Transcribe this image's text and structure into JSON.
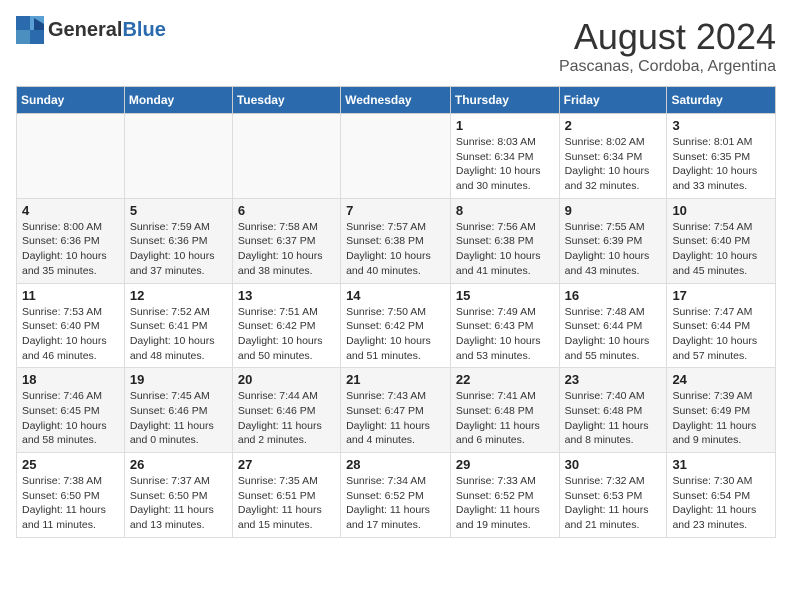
{
  "header": {
    "logo_general": "General",
    "logo_blue": "Blue",
    "title": "August 2024",
    "subtitle": "Pascanas, Cordoba, Argentina"
  },
  "calendar": {
    "days_of_week": [
      "Sunday",
      "Monday",
      "Tuesday",
      "Wednesday",
      "Thursday",
      "Friday",
      "Saturday"
    ],
    "weeks": [
      [
        {
          "num": "",
          "info": ""
        },
        {
          "num": "",
          "info": ""
        },
        {
          "num": "",
          "info": ""
        },
        {
          "num": "",
          "info": ""
        },
        {
          "num": "1",
          "info": "Sunrise: 8:03 AM\nSunset: 6:34 PM\nDaylight: 10 hours and 30 minutes."
        },
        {
          "num": "2",
          "info": "Sunrise: 8:02 AM\nSunset: 6:34 PM\nDaylight: 10 hours and 32 minutes."
        },
        {
          "num": "3",
          "info": "Sunrise: 8:01 AM\nSunset: 6:35 PM\nDaylight: 10 hours and 33 minutes."
        }
      ],
      [
        {
          "num": "4",
          "info": "Sunrise: 8:00 AM\nSunset: 6:36 PM\nDaylight: 10 hours and 35 minutes."
        },
        {
          "num": "5",
          "info": "Sunrise: 7:59 AM\nSunset: 6:36 PM\nDaylight: 10 hours and 37 minutes."
        },
        {
          "num": "6",
          "info": "Sunrise: 7:58 AM\nSunset: 6:37 PM\nDaylight: 10 hours and 38 minutes."
        },
        {
          "num": "7",
          "info": "Sunrise: 7:57 AM\nSunset: 6:38 PM\nDaylight: 10 hours and 40 minutes."
        },
        {
          "num": "8",
          "info": "Sunrise: 7:56 AM\nSunset: 6:38 PM\nDaylight: 10 hours and 41 minutes."
        },
        {
          "num": "9",
          "info": "Sunrise: 7:55 AM\nSunset: 6:39 PM\nDaylight: 10 hours and 43 minutes."
        },
        {
          "num": "10",
          "info": "Sunrise: 7:54 AM\nSunset: 6:40 PM\nDaylight: 10 hours and 45 minutes."
        }
      ],
      [
        {
          "num": "11",
          "info": "Sunrise: 7:53 AM\nSunset: 6:40 PM\nDaylight: 10 hours and 46 minutes."
        },
        {
          "num": "12",
          "info": "Sunrise: 7:52 AM\nSunset: 6:41 PM\nDaylight: 10 hours and 48 minutes."
        },
        {
          "num": "13",
          "info": "Sunrise: 7:51 AM\nSunset: 6:42 PM\nDaylight: 10 hours and 50 minutes."
        },
        {
          "num": "14",
          "info": "Sunrise: 7:50 AM\nSunset: 6:42 PM\nDaylight: 10 hours and 51 minutes."
        },
        {
          "num": "15",
          "info": "Sunrise: 7:49 AM\nSunset: 6:43 PM\nDaylight: 10 hours and 53 minutes."
        },
        {
          "num": "16",
          "info": "Sunrise: 7:48 AM\nSunset: 6:44 PM\nDaylight: 10 hours and 55 minutes."
        },
        {
          "num": "17",
          "info": "Sunrise: 7:47 AM\nSunset: 6:44 PM\nDaylight: 10 hours and 57 minutes."
        }
      ],
      [
        {
          "num": "18",
          "info": "Sunrise: 7:46 AM\nSunset: 6:45 PM\nDaylight: 10 hours and 58 minutes."
        },
        {
          "num": "19",
          "info": "Sunrise: 7:45 AM\nSunset: 6:46 PM\nDaylight: 11 hours and 0 minutes."
        },
        {
          "num": "20",
          "info": "Sunrise: 7:44 AM\nSunset: 6:46 PM\nDaylight: 11 hours and 2 minutes."
        },
        {
          "num": "21",
          "info": "Sunrise: 7:43 AM\nSunset: 6:47 PM\nDaylight: 11 hours and 4 minutes."
        },
        {
          "num": "22",
          "info": "Sunrise: 7:41 AM\nSunset: 6:48 PM\nDaylight: 11 hours and 6 minutes."
        },
        {
          "num": "23",
          "info": "Sunrise: 7:40 AM\nSunset: 6:48 PM\nDaylight: 11 hours and 8 minutes."
        },
        {
          "num": "24",
          "info": "Sunrise: 7:39 AM\nSunset: 6:49 PM\nDaylight: 11 hours and 9 minutes."
        }
      ],
      [
        {
          "num": "25",
          "info": "Sunrise: 7:38 AM\nSunset: 6:50 PM\nDaylight: 11 hours and 11 minutes."
        },
        {
          "num": "26",
          "info": "Sunrise: 7:37 AM\nSunset: 6:50 PM\nDaylight: 11 hours and 13 minutes."
        },
        {
          "num": "27",
          "info": "Sunrise: 7:35 AM\nSunset: 6:51 PM\nDaylight: 11 hours and 15 minutes."
        },
        {
          "num": "28",
          "info": "Sunrise: 7:34 AM\nSunset: 6:52 PM\nDaylight: 11 hours and 17 minutes."
        },
        {
          "num": "29",
          "info": "Sunrise: 7:33 AM\nSunset: 6:52 PM\nDaylight: 11 hours and 19 minutes."
        },
        {
          "num": "30",
          "info": "Sunrise: 7:32 AM\nSunset: 6:53 PM\nDaylight: 11 hours and 21 minutes."
        },
        {
          "num": "31",
          "info": "Sunrise: 7:30 AM\nSunset: 6:54 PM\nDaylight: 11 hours and 23 minutes."
        }
      ]
    ]
  }
}
